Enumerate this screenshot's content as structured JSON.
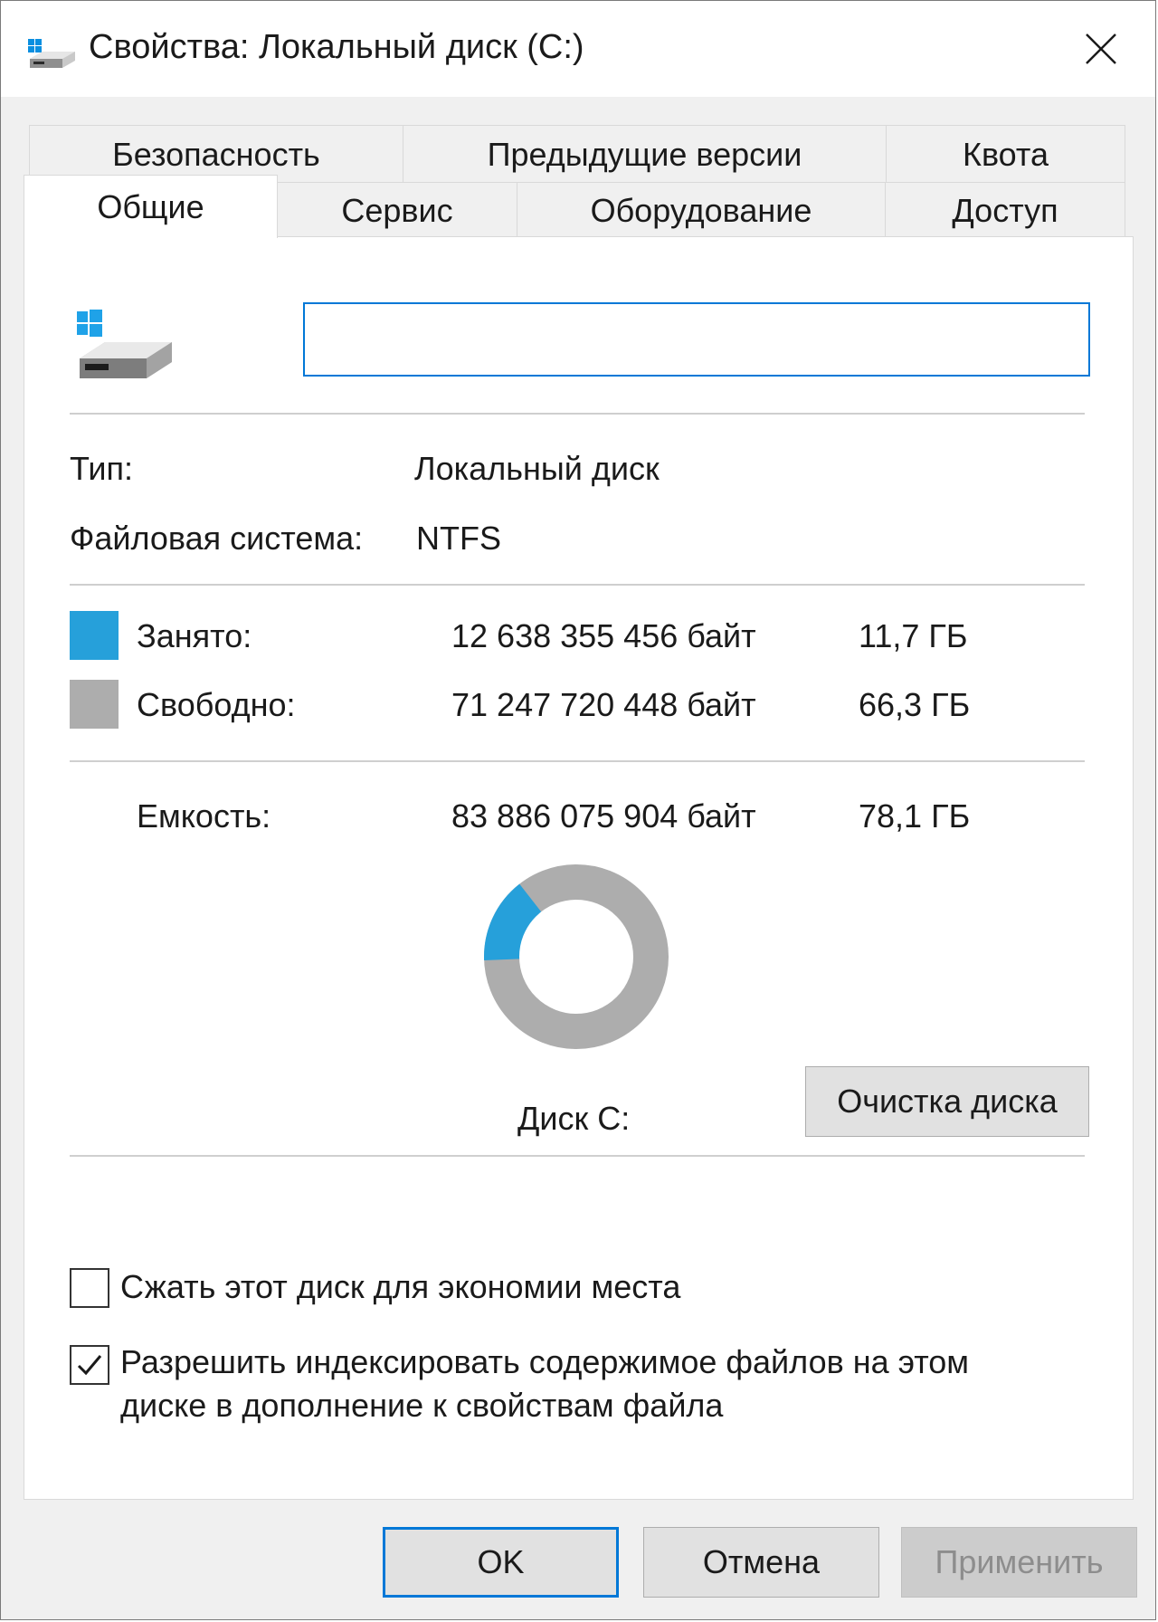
{
  "window": {
    "title": "Свойства: Локальный диск (C:)"
  },
  "tabs": {
    "back_row": [
      "Безопасность",
      "Предыдущие версии",
      "Квота"
    ],
    "front_row": [
      "Общие",
      "Сервис",
      "Оборудование",
      "Доступ"
    ],
    "active": "Общие"
  },
  "general": {
    "volume_label_value": "",
    "type_label": "Тип:",
    "type_value": "Локальный диск",
    "fs_label": "Файловая система:",
    "fs_value": "NTFS",
    "used_label": "Занято:",
    "used_bytes": "12 638 355 456 байт",
    "used_size": "11,7 ГБ",
    "free_label": "Свободно:",
    "free_bytes": "71 247 720 448 байт",
    "free_size": "66,3 ГБ",
    "capacity_label": "Емкость:",
    "capacity_bytes": "83 886 075 904 байт",
    "capacity_size": "78,1 ГБ",
    "disk_caption": "Диск C:",
    "cleanup_button": "Очистка диска",
    "compress_label": "Сжать этот диск для экономии места",
    "compress_checked": false,
    "index_label": "Разрешить индексировать содержимое файлов на этом диске в дополнение к свойствам файла",
    "index_checked": true
  },
  "usage": {
    "used_fraction": 0.1507,
    "used_color": "#26a0da",
    "free_color": "#adadad"
  },
  "buttons": {
    "ok": "OK",
    "cancel": "Отмена",
    "apply": "Применить"
  }
}
